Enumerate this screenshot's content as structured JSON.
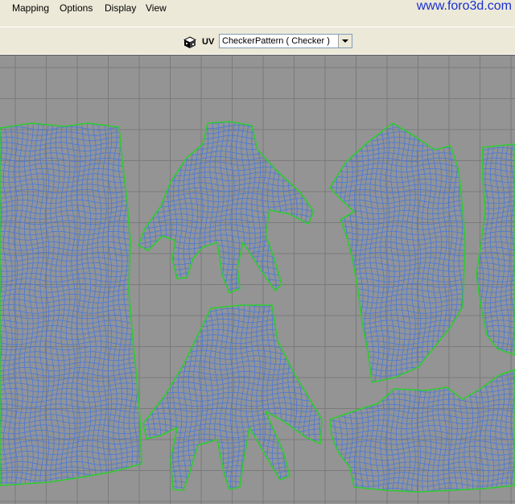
{
  "menu": {
    "items": [
      {
        "label": "Mapping"
      },
      {
        "label": "Options"
      },
      {
        "label": "Display"
      },
      {
        "label": "View"
      }
    ]
  },
  "watermark": "www.foro3d.com",
  "toolbar": {
    "uv_label": "UV",
    "texture_select": {
      "value": "CheckerPattern  ( Checker )"
    }
  },
  "colors": {
    "viewport_bg": "#949494",
    "grid_line": "#7a7a7a",
    "mesh_line": "#4a78d8",
    "uv_border": "#2ecc2e"
  },
  "viewport": {
    "shells": [
      {
        "name": "torso-front-shell"
      },
      {
        "name": "hand-upper-shell"
      },
      {
        "name": "hand-lower-shell"
      },
      {
        "name": "torso-back-shell"
      },
      {
        "name": "arm-shell"
      },
      {
        "name": "bottom-right-shell"
      }
    ]
  }
}
